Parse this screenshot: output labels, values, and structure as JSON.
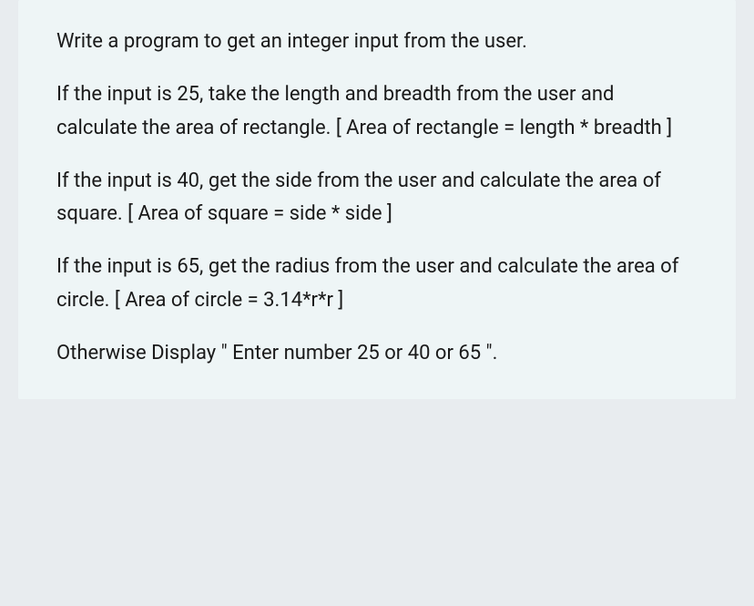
{
  "paragraphs": {
    "p1": "Write a program to get an integer input from the user.",
    "p2": "If the input is 25, take the length and breadth from the user and calculate the area of rectangle. [ Area of rectangle = length * breadth ]",
    "p3": "If the input is 40, get the side from the user and calculate the area of square. [ Area of square = side * side ]",
    "p4": "If the input is 65, get the radius from the user and calculate the area of circle. [ Area of circle = 3.14*r*r ]",
    "p5": "Otherwise Display \" Enter number 25 or 40 or 65 \"."
  }
}
